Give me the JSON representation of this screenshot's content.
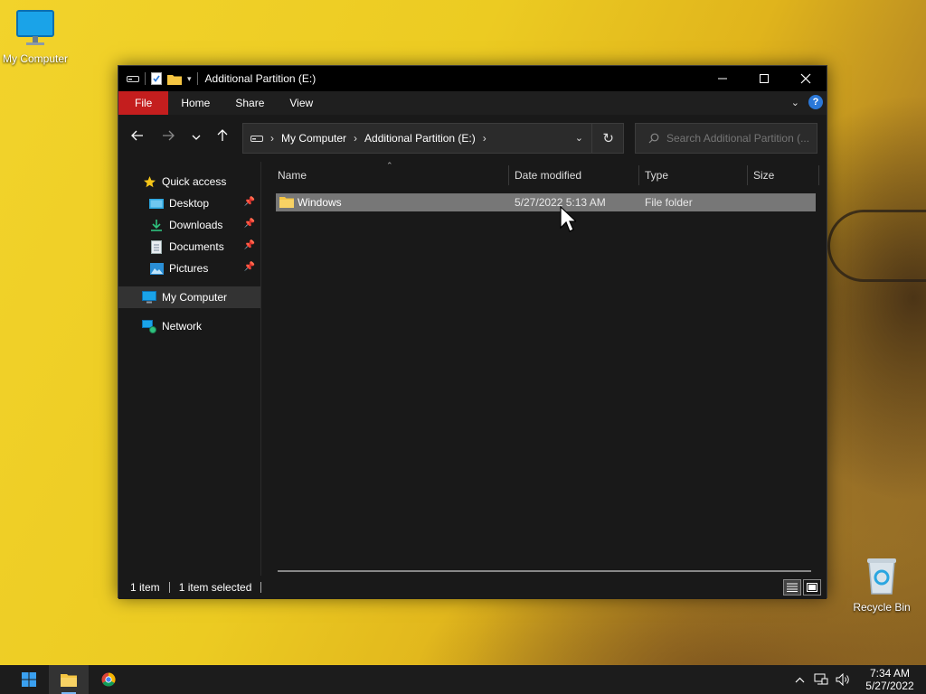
{
  "desktop": {
    "icons": [
      {
        "label": "My Computer"
      },
      {
        "label": "Recycle Bin"
      }
    ]
  },
  "window": {
    "title": "Additional Partition (E:)",
    "ribbon": {
      "tabs": [
        {
          "label": "File"
        },
        {
          "label": "Home"
        },
        {
          "label": "Share"
        },
        {
          "label": "View"
        }
      ]
    },
    "address": {
      "crumbs": [
        "My Computer",
        "Additional Partition (E:)"
      ]
    },
    "search": {
      "placeholder": "Search Additional Partition (..."
    },
    "sidebar": {
      "items": [
        {
          "label": "Quick access"
        },
        {
          "label": "Desktop"
        },
        {
          "label": "Downloads"
        },
        {
          "label": "Documents"
        },
        {
          "label": "Pictures"
        },
        {
          "label": "My Computer"
        },
        {
          "label": "Network"
        }
      ]
    },
    "columns": [
      "Name",
      "Date modified",
      "Type",
      "Size"
    ],
    "files": [
      {
        "name": "Windows",
        "date_modified": "5/27/2022 5:13 AM",
        "type": "File folder",
        "size": ""
      }
    ],
    "status": {
      "count": "1 item",
      "selected": "1 item selected"
    }
  },
  "taskbar": {
    "time": "7:34 AM",
    "date": "5/27/2022"
  },
  "colors": {
    "file_tab": "#c41e1e",
    "selection": "#777777",
    "accent": "#2b78d8",
    "folder": "#f5c542"
  }
}
